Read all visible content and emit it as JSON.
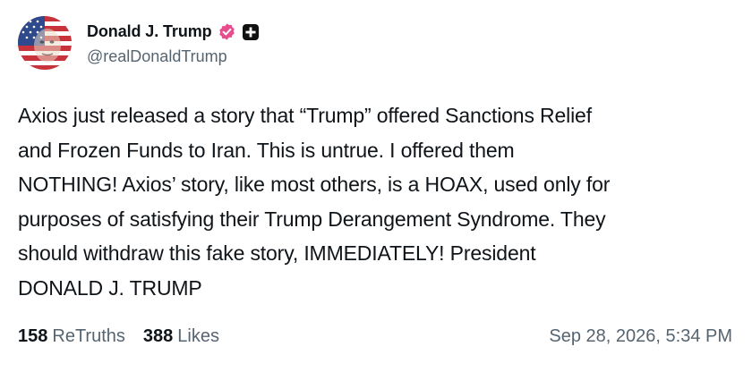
{
  "author": {
    "display_name": "Donald J. Trump",
    "handle": "@realDonaldTrump",
    "avatar_icon": "flag-portrait-avatar",
    "verified_icon": "verified-badge-icon",
    "plus_icon": "plus-badge-icon"
  },
  "post": {
    "text": "Axios just released a story that “Trump” offered Sanctions Relief\nand Frozen Funds to Iran. This is untrue. I offered them\nNOTHING! Axios’ story, like most others, is a HOAX, used only for\npurposes of satisfying their Trump Derangement Syndrome. They\nshould withdraw this fake story, IMMEDIATELY! President\nDONALD J. TRUMP"
  },
  "stats": {
    "retruths_count": "158",
    "retruths_label": "ReTruths",
    "likes_count": "388",
    "likes_label": "Likes"
  },
  "timestamp": "Sep 28, 2026, 5:34 PM",
  "colors": {
    "verified": "#e64d8c",
    "text": "#0f1419",
    "muted": "#566470"
  }
}
